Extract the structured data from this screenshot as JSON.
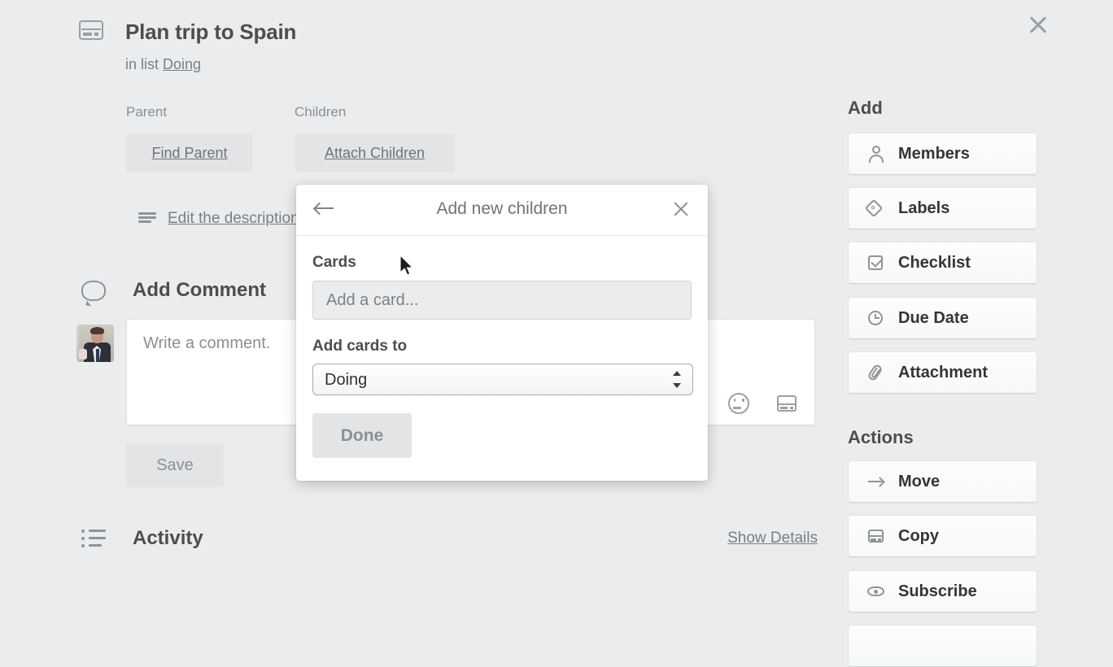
{
  "window": {
    "close_label": "×"
  },
  "card": {
    "icon": "card-icon",
    "title": "Plan trip to Spain",
    "in_list_prefix": "in list",
    "list_name": "Doing"
  },
  "relations": {
    "parent_label": "Parent",
    "children_label": "Children",
    "find_parent_button": "Find Parent",
    "attach_children_button": "Attach Children"
  },
  "description": {
    "icon": "description-lines-icon",
    "link": "Edit the description..."
  },
  "comment": {
    "icon": "speech-bubble-icon",
    "heading": "Add Comment",
    "placeholder": "Write a comment.",
    "emoji_icon": "smiley-icon",
    "card_icon": "card-icon",
    "save_label": "Save"
  },
  "activity": {
    "icon": "activity-list-icon",
    "heading": "Activity",
    "show_details": "Show Details"
  },
  "sidebar": {
    "add_heading": "Add",
    "add_items": [
      {
        "label": "Members",
        "icon": "person-icon"
      },
      {
        "label": "Labels",
        "icon": "tag-icon"
      },
      {
        "label": "Checklist",
        "icon": "checkbox-icon"
      },
      {
        "label": "Due Date",
        "icon": "clock-icon"
      },
      {
        "label": "Attachment",
        "icon": "paperclip-icon"
      }
    ],
    "actions_heading": "Actions",
    "action_items": [
      {
        "label": "Move",
        "icon": "arrow-right-icon"
      },
      {
        "label": "Copy",
        "icon": "card-icon"
      },
      {
        "label": "Subscribe",
        "icon": "eye-icon"
      }
    ]
  },
  "modal": {
    "back_icon": "arrow-left-icon",
    "title": "Add new children",
    "close_icon": "close-icon",
    "cards_label": "Cards",
    "card_input_placeholder": "Add a card...",
    "card_input_value": "",
    "add_cards_to_label": "Add cards to",
    "selected_list": "Doing",
    "list_options": [
      "Doing"
    ],
    "done_label": "Done"
  },
  "colors": {
    "page_background": "#eaecee",
    "modal_background": "#ffffff",
    "muted_text": "#7a7f83",
    "strong_text": "#4d4d4d",
    "button_grey": "#e2e4e6"
  }
}
